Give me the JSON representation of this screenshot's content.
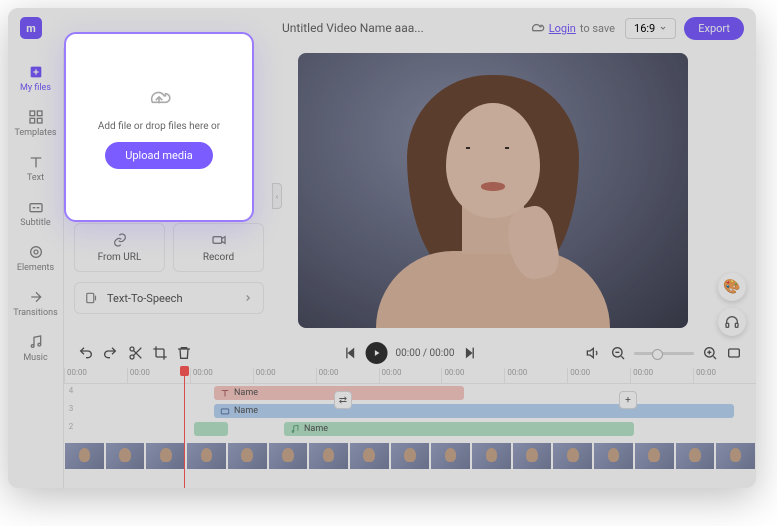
{
  "header": {
    "logo_letter": "m",
    "project_title": "Untitled Video Name aaa...",
    "login_label": "Login",
    "login_suffix": "to save",
    "aspect_ratio": "16:9",
    "export_label": "Export"
  },
  "sidebar": {
    "items": [
      {
        "label": "My files"
      },
      {
        "label": "Templates"
      },
      {
        "label": "Text"
      },
      {
        "label": "Subtitle"
      },
      {
        "label": "Elements"
      },
      {
        "label": "Transitions"
      },
      {
        "label": "Music"
      }
    ]
  },
  "upload": {
    "drop_text": "Add file or drop files here or",
    "button": "Upload media"
  },
  "panel": {
    "from_url": "From URL",
    "record": "Record",
    "tts": "Text-To-Speech"
  },
  "player": {
    "time": "00:00 / 00:00"
  },
  "timeline": {
    "ticks": [
      "00:00",
      "00:00",
      "00:00",
      "00:00",
      "00:00",
      "00:00",
      "00:00",
      "00:00",
      "00:00",
      "00:00",
      "00:00"
    ],
    "clips": {
      "text": "Name",
      "subtitle": "Name",
      "audio": "Name"
    }
  },
  "colors": {
    "accent": "#7B5CFF"
  }
}
